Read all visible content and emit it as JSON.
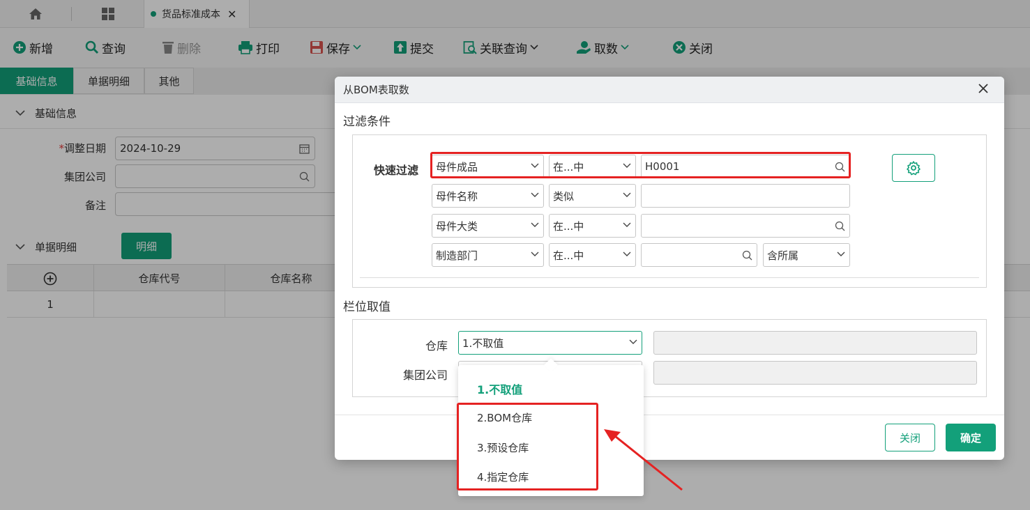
{
  "tabs": {
    "doc_title": "货品标准成本",
    "close_glyph": "✕"
  },
  "toolbar": {
    "add": "新增",
    "query": "查询",
    "delete": "删除",
    "print": "打印",
    "save": "保存",
    "submit": "提交",
    "related_query": "关联查询",
    "fetch": "取数",
    "close": "关闭"
  },
  "section_tabs": [
    "基础信息",
    "单据明细",
    "其他"
  ],
  "basic": {
    "header": "基础信息",
    "adjust_date_label": "调整日期",
    "adjust_date_value": "2024-10-29",
    "group_company_label": "集团公司",
    "remarks_label": "备注",
    "required_mark": "*"
  },
  "detail": {
    "header": "单据明细",
    "detail_button": "明细",
    "columns": [
      "仓库代号",
      "仓库名称"
    ],
    "rows": [
      {
        "index": "1"
      }
    ]
  },
  "modal": {
    "title": "从BOM表取数",
    "filter_title": "过滤条件",
    "quick_filter_label": "快速过滤",
    "filters": [
      {
        "field": "母件成品",
        "op": "在...中",
        "value": "H0001"
      },
      {
        "field": "母件名称",
        "op": "类似",
        "value": ""
      },
      {
        "field": "母件大类",
        "op": "在...中",
        "value": ""
      },
      {
        "field": "制造部门",
        "op": "在...中",
        "value": "",
        "extra": "含所属"
      }
    ],
    "column_title": "栏位取值",
    "columns": [
      {
        "label": "仓库",
        "value": "1.不取值"
      },
      {
        "label": "集团公司",
        "value": ""
      }
    ],
    "close_button": "关闭",
    "confirm_button": "确定"
  },
  "dropdown": {
    "options": [
      "1.不取值",
      "2.BOM仓库",
      "3.预设仓库",
      "4.指定仓库"
    ],
    "selected": "1.不取值"
  },
  "colors": {
    "accent": "#13a07a",
    "highlight": "#e52222"
  }
}
